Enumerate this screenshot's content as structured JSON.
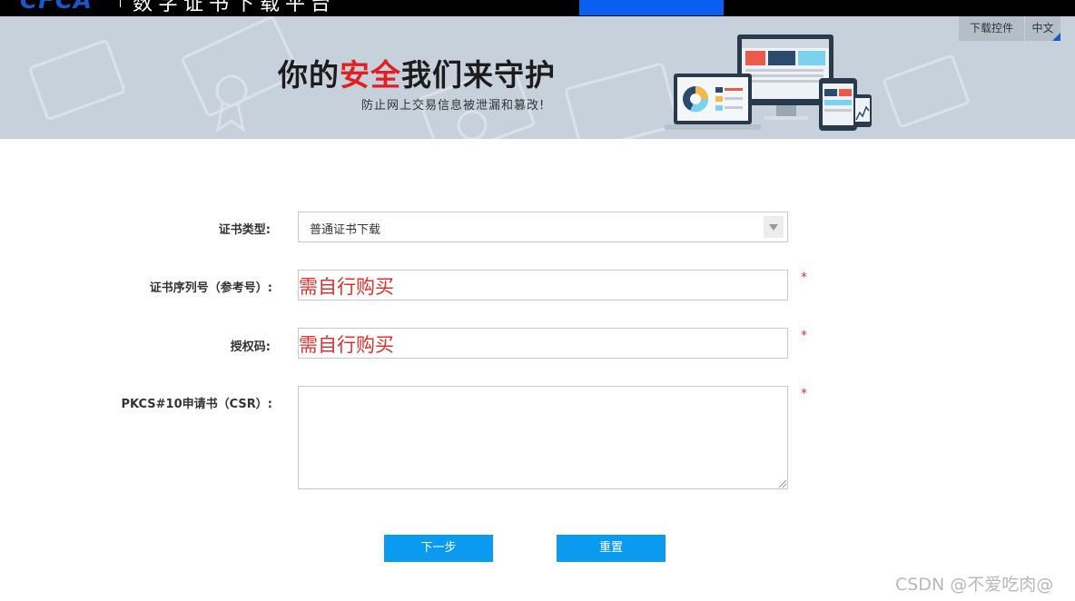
{
  "header": {
    "logo_text": "CFCA",
    "title": "数字证书下载平台"
  },
  "banner": {
    "slogan_part1": "你的",
    "slogan_highlight": "安全",
    "slogan_part2": "我们来守护",
    "subtitle": "防止网上交易信息被泄漏和篡改!",
    "highlight_color": "#e02020"
  },
  "toolbar": {
    "download_label": "下载控件",
    "language_label": "中文"
  },
  "form": {
    "cert_type": {
      "label": "证书类型:",
      "selected": "普通证书下载"
    },
    "serial": {
      "label": "证书序列号（参考号）:",
      "value": "需自行购买",
      "required": "*"
    },
    "auth_code": {
      "label": "授权码:",
      "value": "需自行购买",
      "required": "*"
    },
    "csr": {
      "label": "PKCS#10申请书（CSR）:",
      "value": "",
      "required": "*"
    }
  },
  "buttons": {
    "next_label": "下一步",
    "reset_label": "重置",
    "color": "#0a9bf0"
  },
  "watermark": "CSDN @不爱吃肉@"
}
